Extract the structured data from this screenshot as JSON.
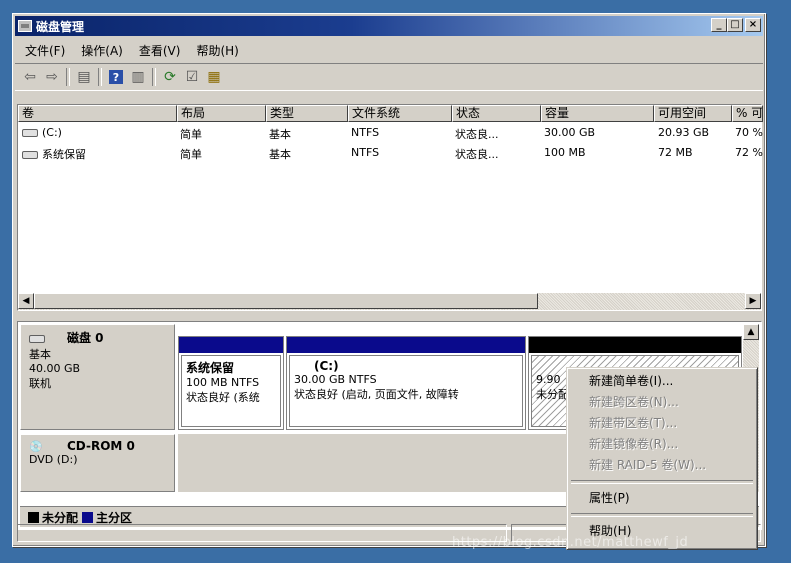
{
  "window": {
    "title": "磁盘管理",
    "minimize": "_",
    "maximize": "□",
    "close": "×"
  },
  "menu": [
    "文件(F)",
    "操作(A)",
    "查看(V)",
    "帮助(H)"
  ],
  "list": {
    "headers": [
      "卷",
      "布局",
      "类型",
      "文件系统",
      "状态",
      "容量",
      "可用空间",
      "% 可"
    ],
    "rows": [
      [
        "(C:)",
        "简单",
        "基本",
        "NTFS",
        "状态良...",
        "30.00 GB",
        "20.93 GB",
        "70 %"
      ],
      [
        "系统保留",
        "简单",
        "基本",
        "NTFS",
        "状态良...",
        "100 MB",
        "72 MB",
        "72 %"
      ]
    ]
  },
  "disks": [
    {
      "name": "磁盘 0",
      "type": "基本",
      "size": "40.00 GB",
      "state": "联机",
      "partitions": [
        {
          "name": "系统保留",
          "detail": "100 MB NTFS",
          "status": "状态良好 (系统"
        },
        {
          "name": "(C:)",
          "detail": "30.00 GB NTFS",
          "status": "状态良好 (启动, 页面文件, 故障转"
        },
        {
          "name": "",
          "detail": "9.90",
          "status": "未分配"
        }
      ]
    },
    {
      "name": "CD-ROM 0",
      "type": "DVD (D:)"
    }
  ],
  "legend": [
    "未分配",
    "主分区"
  ],
  "context_menu": {
    "items": [
      {
        "label": "新建简单卷(I)...",
        "enabled": true
      },
      {
        "label": "新建跨区卷(N)...",
        "enabled": false
      },
      {
        "label": "新建带区卷(T)...",
        "enabled": false
      },
      {
        "label": "新建镜像卷(R)...",
        "enabled": false
      },
      {
        "label": "新建 RAID-5 卷(W)...",
        "enabled": false
      }
    ],
    "properties": "属性(P)",
    "help": "帮助(H)"
  },
  "colors": {
    "primary_partition": "#0a0a8c",
    "unallocated": "#000000",
    "titlebar": "#0a246a"
  },
  "watermark": "https://blog.csdn.net/matthewf_jd"
}
